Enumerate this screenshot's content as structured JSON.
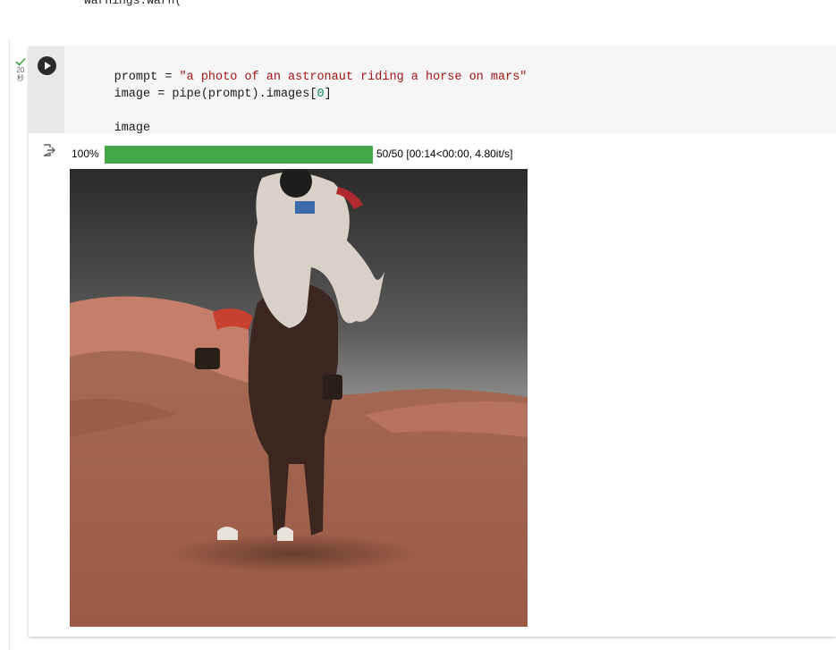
{
  "previous_output": {
    "text": "warnings.warn("
  },
  "execution": {
    "time_value": "20",
    "time_unit": "秒"
  },
  "cell": {
    "code_lines": [
      {
        "id": "line1",
        "tokens": [
          {
            "text": "prompt = ",
            "kind": "plain"
          },
          {
            "text": "\"a photo of an astronaut riding a horse on mars\"",
            "kind": "string"
          }
        ]
      },
      {
        "id": "line2",
        "tokens": [
          {
            "text": "image = pipe(prompt).images[",
            "kind": "plain"
          },
          {
            "text": "0",
            "kind": "number"
          },
          {
            "text": "]",
            "kind": "plain"
          }
        ]
      },
      {
        "id": "line3",
        "tokens": [
          {
            "text": "image",
            "kind": "plain"
          }
        ]
      }
    ]
  },
  "output": {
    "progress": {
      "label": "100%",
      "fraction": 1.0,
      "info": "50/50 [00:14<00:00, 4.80it/s]"
    }
  },
  "colors": {
    "progress_fill": "#45a748",
    "check": "#43a047",
    "string": "#a31515",
    "number": "#098658"
  },
  "icons": {
    "run": "play-circle-icon",
    "check": "check-icon",
    "output": "output-redirect-icon"
  }
}
